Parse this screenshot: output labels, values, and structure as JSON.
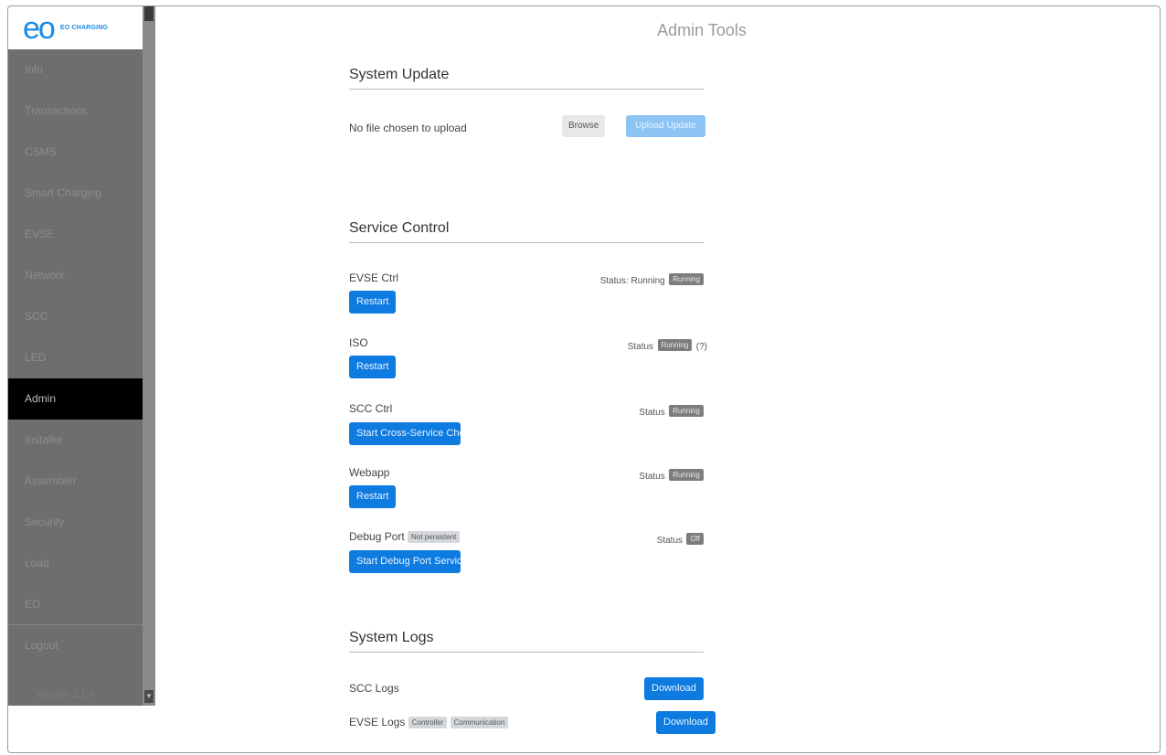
{
  "logo": {
    "mark": "eo",
    "text": "EO CHARGING"
  },
  "page_title": "Admin Tools",
  "sidebar": {
    "items": [
      {
        "label": "Info",
        "active": false
      },
      {
        "label": "Transactions",
        "active": false
      },
      {
        "label": "CSMS",
        "active": false
      },
      {
        "label": "Smart Charging",
        "active": false
      },
      {
        "label": "EVSE",
        "active": false
      },
      {
        "label": "Network",
        "active": false
      },
      {
        "label": "SCC",
        "active": false
      },
      {
        "label": "LED",
        "active": false
      },
      {
        "label": "Admin",
        "active": true
      },
      {
        "label": "Installer",
        "active": false
      },
      {
        "label": "Assembler",
        "active": false
      },
      {
        "label": "Security",
        "active": false
      },
      {
        "label": "Load",
        "active": false
      },
      {
        "label": "EO",
        "active": false
      }
    ],
    "logout": "Logout",
    "version": "Version 2.1.0"
  },
  "system_update": {
    "title": "System Update",
    "file_label": "No file chosen to upload",
    "browse_button": "Browse",
    "upload_button": "Upload Update"
  },
  "service_control": {
    "title": "Service Control",
    "services": [
      {
        "name": "EVSE Ctrl",
        "status_label": "Status: Running",
        "badge": "Running",
        "button": "Restart"
      },
      {
        "name": "ISO",
        "status_label": "Status",
        "badge": "Running",
        "extra": "(?)",
        "button": "Restart"
      },
      {
        "name": "SCC Ctrl",
        "status_label": "Status",
        "badge": "Running",
        "button": "Start Cross-Service Check"
      },
      {
        "name": "Webapp",
        "status_label": "Status",
        "badge": "Running",
        "button": "Restart"
      },
      {
        "name": "Debug Port",
        "tag": "Not persistent",
        "status_label": "Status",
        "badge": "Off",
        "button": "Start Debug Port Service"
      }
    ]
  },
  "system_logs": {
    "title": "System Logs",
    "rows": [
      {
        "label": "SCC Logs",
        "tags": [],
        "button": "Download"
      },
      {
        "label": "EVSE Logs",
        "tags": [
          "Controller",
          "Communication"
        ],
        "button": "Download"
      }
    ]
  },
  "colors": {
    "accent": "#0d7be0",
    "sidebar": "#6e6e6e",
    "active_nav": "#000000",
    "logo": "#1a8ae6"
  }
}
